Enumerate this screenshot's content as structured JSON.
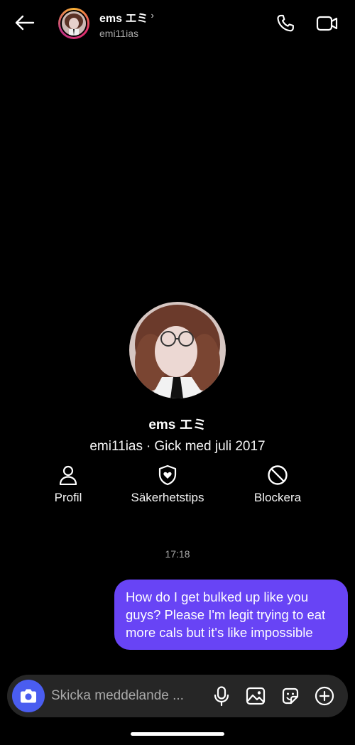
{
  "header": {
    "name": "ems エミ",
    "chevron": "›",
    "username": "emi11ias",
    "icons": {
      "back": "arrow-left-icon",
      "call": "phone-icon",
      "video": "video-camera-icon"
    }
  },
  "profile": {
    "name": "ems エミ",
    "username": "emi11ias",
    "separator": "·",
    "joined": "Gick med juli 2017"
  },
  "actions": [
    {
      "label": "Profil",
      "icon": "person-icon"
    },
    {
      "label": "Säkerhetstips",
      "icon": "shield-heart-icon"
    },
    {
      "label": "Blockera",
      "icon": "block-icon"
    }
  ],
  "conversation": {
    "timestamp": "17:18",
    "messages": [
      {
        "sender": "me",
        "text": "How do I get bulked up like you guys? Please I'm legit trying to eat more cals but it's like impossible"
      }
    ]
  },
  "composer": {
    "placeholder": "Skicka meddelande ...",
    "value": "",
    "icons": [
      "camera-icon",
      "microphone-icon",
      "gallery-icon",
      "sticker-icon",
      "plus-circle-icon"
    ]
  },
  "colors": {
    "background": "#000000",
    "bubble": "#6844f5",
    "composer": "#262626",
    "camera_button": "#4a5df0",
    "muted_text": "#a8a8a8"
  }
}
